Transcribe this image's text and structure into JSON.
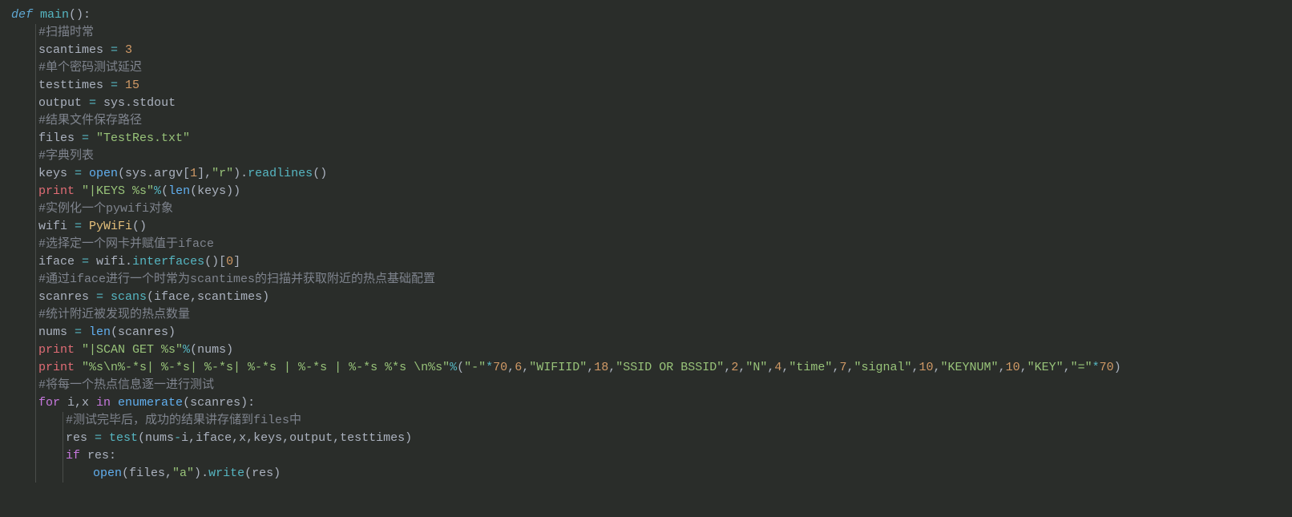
{
  "code": {
    "l1_def": "def",
    "l1_main": " main",
    "l1_paren": "():",
    "c1": "#扫描时常",
    "l2a": "scantimes ",
    "l2op": "=",
    "l2n": " 3",
    "c2": "#单个密码测试延迟",
    "l3a": "testtimes ",
    "l3op": "=",
    "l3n": " 15",
    "l4a": "output ",
    "l4op": "=",
    "l4b": " sys",
    "l4c": ".",
    "l4d": "stdout",
    "c3": "#结果文件保存路径",
    "l5a": "files ",
    "l5op": "=",
    "l5s": " \"TestRes.txt\"",
    "c4": "#字典列表",
    "l6a": "keys ",
    "l6op": "=",
    "l6b": " open",
    "l6c": "(sys",
    "l6d": ".",
    "l6e": "argv[",
    "l6f": "1",
    "l6g": "],",
    "l6h": "\"r\"",
    "l6i": ")",
    "l6j": ".",
    "l6k": "readlines",
    "l6l": "()",
    "l7a": "print",
    "l7s": " \"|KEYS %s\"",
    "l7op": "%",
    "l7b": "(",
    "l7c": "len",
    "l7d": "(keys))",
    "c5": "#实例化一个pywifi对象",
    "l8a": "wifi ",
    "l8op": "=",
    "l8b": " PyWiFi",
    "l8c": "()",
    "c6": "#选择定一个网卡并赋值于iface",
    "l9a": "iface ",
    "l9op": "=",
    "l9b": " wifi",
    "l9c": ".",
    "l9d": "interfaces",
    "l9e": "()[",
    "l9f": "0",
    "l9g": "]",
    "c7": "#通过iface进行一个时常为scantimes的扫描并获取附近的热点基础配置",
    "l10a": "scanres ",
    "l10op": "=",
    "l10b": " scans",
    "l10c": "(iface,scantimes)",
    "c8": "#统计附近被发现的热点数量",
    "l11a": "nums ",
    "l11op": "=",
    "l11b": " len",
    "l11c": "(scanres)",
    "l12a": "print",
    "l12s": " \"|SCAN GET %s\"",
    "l12op": "%",
    "l12b": "(nums)",
    "l13a": "print",
    "l13s": " \"%s\\n%-*s| %-*s| %-*s| %-*s | %-*s | %-*s %*s \\n%s\"",
    "l13op": "%",
    "l13p1": "(",
    "l13s2": "\"-\"",
    "l13op2": "*",
    "l13n1": "70",
    "l13c1": ",",
    "l13n2": "6",
    "l13c2": ",",
    "l13s3": "\"WIFIID\"",
    "l13c3": ",",
    "l13n3": "18",
    "l13c4": ",",
    "l13s4": "\"SSID OR BSSID\"",
    "l13c5": ",",
    "l13n4": "2",
    "l13c6": ",",
    "l13s5": "\"N\"",
    "l13c7": ",",
    "l13n5": "4",
    "l13c8": ",",
    "l13s6": "\"time\"",
    "l13c9": ",",
    "l13n6": "7",
    "l13c10": ",",
    "l13s7": "\"signal\"",
    "l13c11": ",",
    "l13n7": "10",
    "l13c12": ",",
    "l13s8": "\"KEYNUM\"",
    "l13c13": ",",
    "l13n8": "10",
    "l13c14": ",",
    "l13s9": "\"KEY\"",
    "l13c15": ",",
    "l13s10": "\"=\"",
    "l13op3": "*",
    "l13n9": "70",
    "l13p2": ")",
    "c9": "#将每一个热点信息逐一进行测试",
    "l14a": "for",
    "l14b": " i,x ",
    "l14c": "in",
    "l14d": " enumerate",
    "l14e": "(scanres):",
    "c10": "#测试完毕后，成功的结果讲存储到files中",
    "l15a": "res ",
    "l15op": "=",
    "l15b": " test",
    "l15c": "(nums",
    "l15op2": "-",
    "l15d": "i,iface,x,keys,output,testtimes)",
    "l16a": "if",
    "l16b": " res:",
    "l17a": "open",
    "l17b": "(files,",
    "l17c": "\"a\"",
    "l17d": ")",
    "l17e": ".",
    "l17f": "write",
    "l17g": "(res)"
  }
}
